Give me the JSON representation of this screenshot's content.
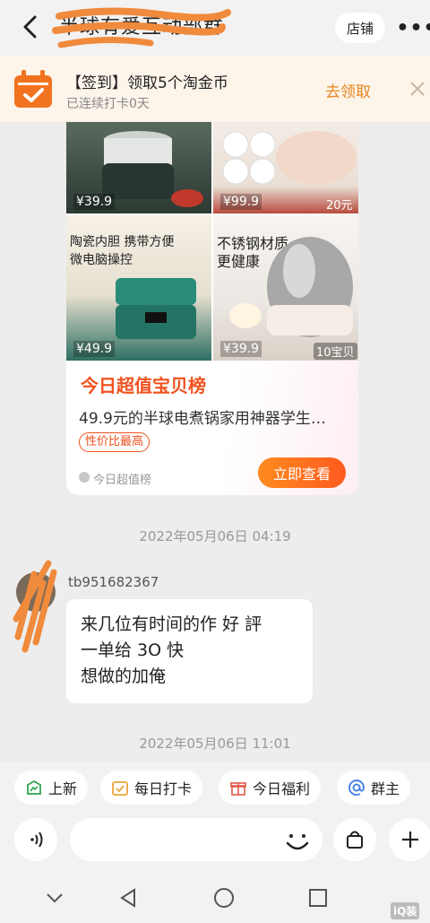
{
  "header": {
    "title": "半球有爱互动部群",
    "store_label": "店铺",
    "more_label": "•••"
  },
  "banner": {
    "title": "【签到】领取5个淘金币",
    "subtitle": "已连续打卡0天",
    "claim_label": "去领取"
  },
  "card": {
    "tiles": {
      "tl_price": "¥39.9",
      "tr_price": "¥99.9",
      "bl_price": "¥49.9",
      "br_price": "¥39.9",
      "bl_text_1": "陶瓷内胆 携带方便",
      "bl_text_2": "微电脑操控",
      "br_text_1": "不锈钢材质",
      "br_text_2": "更健康",
      "br_badge": "10宝贝",
      "tr_coupon": "20元"
    },
    "headline": "今日超值宝贝榜",
    "description": "49.9元的半球电煮锅家用神器学生…",
    "tag": "性价比最高",
    "source": "今日超值榜",
    "cta": "立即查看"
  },
  "timestamps": [
    "2022年05月06日 04:19",
    "2022年05月06日 11:01"
  ],
  "message": {
    "sender": "tb951682367",
    "lines": [
      "来几位有时间的作 好 評",
      "一单给 3O 快",
      "想做的加俺"
    ]
  },
  "quick_actions": [
    {
      "label": "上新",
      "icon": "new-arrival-icon",
      "color": "#2fa44f"
    },
    {
      "label": "每日打卡",
      "icon": "calendar-check-icon",
      "color": "#e9a23b"
    },
    {
      "label": "今日福利",
      "icon": "gift-icon",
      "color": "#e2584c"
    },
    {
      "label": "群主",
      "icon": "at-icon",
      "color": "#3b7be8"
    }
  ],
  "input": {
    "placeholder": ""
  },
  "watermark": "iQ装"
}
